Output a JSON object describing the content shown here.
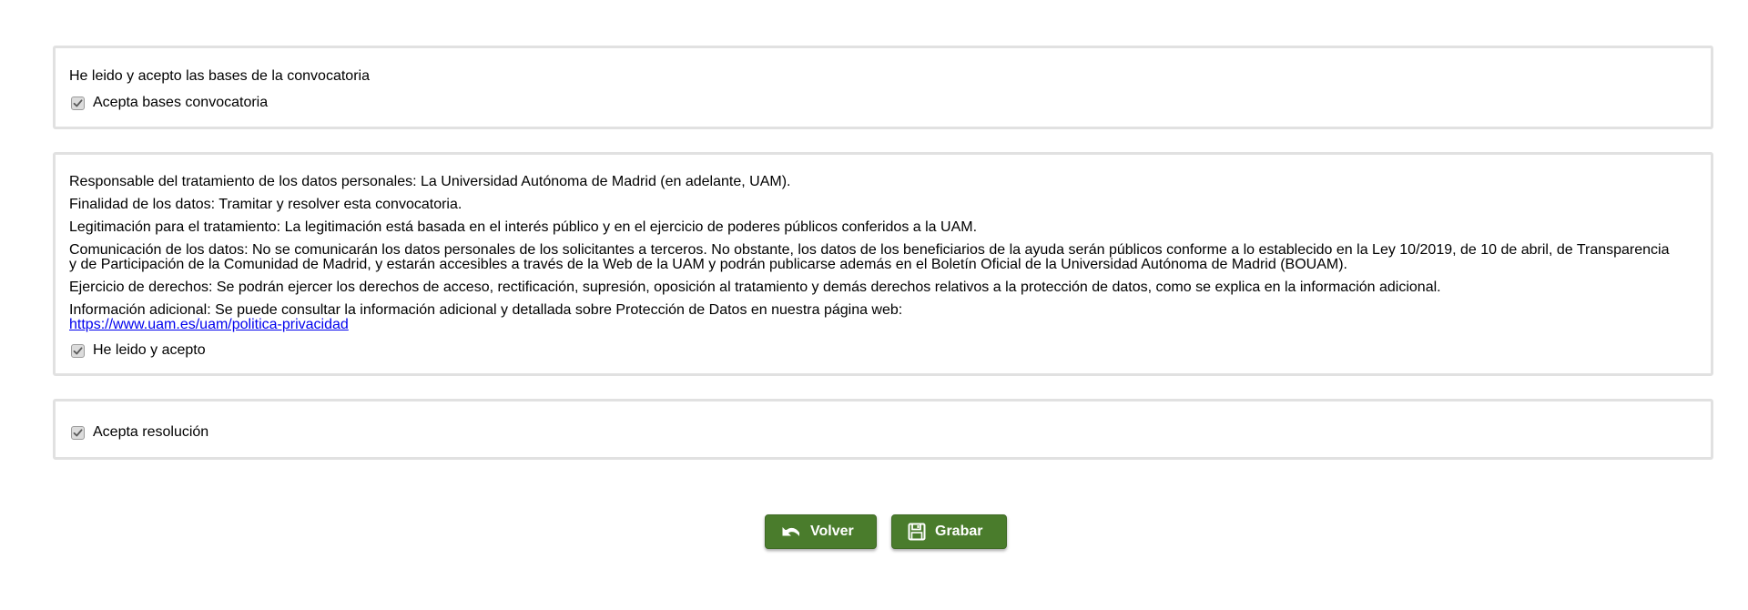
{
  "bases": {
    "statement": "He leido y acepto las bases de la convocatoria",
    "checkbox_label": "Acepta bases convocatoria",
    "checked": true
  },
  "privacy": {
    "responsable": "Responsable del tratamiento de los datos personales: La Universidad Autónoma de Madrid (en adelante, UAM).",
    "finalidad": "Finalidad de los datos: Tramitar y resolver esta convocatoria.",
    "legitimacion": "Legitimación para el tratamiento: La legitimación está basada en el interés público y en el ejercicio de poderes públicos conferidos a la UAM.",
    "comunicacion": "Comunicación de los datos: No se comunicarán los datos personales de los solicitantes a terceros. No obstante, los datos de los beneficiarios de la ayuda serán públicos conforme a lo establecido en la Ley 10/2019, de 10 de abril, de Transparencia y de Participación de la Comunidad de Madrid, y estarán accesibles a través de la Web de la UAM y podrán publicarse además en el Boletín Oficial de la Universidad Autónoma de Madrid (BOUAM).",
    "ejercicio": "Ejercicio de derechos: Se podrán ejercer los derechos de acceso, rectificación, supresión, oposición al tratamiento y demás derechos relativos a la protección de datos, como se explica en la información adicional.",
    "informacion": "Información adicional: Se puede consultar la información adicional y detallada sobre Protección de Datos en nuestra página web:",
    "link_text": "https://www.uam.es/uam/politica-privacidad",
    "checkbox_label": "He leido y acepto",
    "checked": true
  },
  "resolucion": {
    "checkbox_label": "Acepta resolución",
    "checked": true
  },
  "actions": {
    "back_label": "Volver",
    "save_label": "Grabar",
    "button_color": "#4a7c2c"
  }
}
